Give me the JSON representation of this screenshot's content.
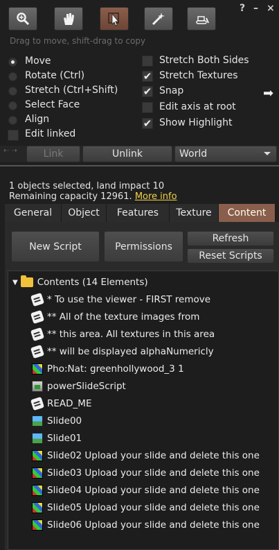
{
  "toolbar": {
    "tools": [
      {
        "name": "focus-tool",
        "icon": "magnifier-icon"
      },
      {
        "name": "grab-tool",
        "icon": "hand-icon"
      },
      {
        "name": "edit-tool",
        "icon": "arrow-cursor-icon",
        "active": true
      },
      {
        "name": "create-tool",
        "icon": "magic-wand-icon"
      },
      {
        "name": "land-tool",
        "icon": "bulldozer-icon"
      }
    ],
    "help_label": "?",
    "minimize_label": "–",
    "close_label": "×",
    "hint": "Drag to move, shift-drag to copy"
  },
  "modes": {
    "move": "Move",
    "rotate": "Rotate (Ctrl)",
    "stretch": "Stretch (Ctrl+Shift)",
    "select_face": "Select Face",
    "align": "Align",
    "selected": "move"
  },
  "edit_linked": {
    "label": "Edit linked",
    "checked": false
  },
  "options": {
    "stretch_both_sides": {
      "label": "Stretch Both Sides",
      "checked": false
    },
    "stretch_textures": {
      "label": "Stretch Textures",
      "checked": true
    },
    "snap": {
      "label": "Snap",
      "checked": true
    },
    "edit_axis_at_root": {
      "label": "Edit axis at root",
      "checked": false
    },
    "show_highlight": {
      "label": "Show Highlight",
      "checked": true
    }
  },
  "link_bar": {
    "link_label": "Link",
    "unlink_label": "Unlink",
    "ruler_value": "World"
  },
  "status": {
    "line1": "1 objects selected, land impact 10",
    "line2_prefix": "Remaining capacity 12961.",
    "more_info": "More info"
  },
  "tabs": [
    "General",
    "Object",
    "Features",
    "Texture",
    "Content"
  ],
  "active_tab": "Content",
  "content_buttons": {
    "new_script": "New Script",
    "permissions": "Permissions",
    "refresh": "Refresh",
    "reset_scripts": "Reset Scripts"
  },
  "inventory": {
    "root": "Contents (14 Elements)",
    "items": [
      {
        "icon": "notecard-icon",
        "label": "* To use the viewer - FIRST remove"
      },
      {
        "icon": "notecard-icon",
        "label": "** All of the texture images from"
      },
      {
        "icon": "notecard-icon",
        "label": "** this area. All textures in this area"
      },
      {
        "icon": "notecard-icon",
        "label": "** will be displayed alphaNumericly"
      },
      {
        "icon": "texture-icon",
        "label": "Pho:Nat: greenhollywood_3 1"
      },
      {
        "icon": "script-icon",
        "label": "powerSlideScript"
      },
      {
        "icon": "notecard-icon",
        "label": "READ_ME"
      },
      {
        "icon": "snapshot-icon",
        "label": "Slide00"
      },
      {
        "icon": "snapshot-icon",
        "label": "Slide01"
      },
      {
        "icon": "texture-icon",
        "label": "Slide02 Upload your slide and delete this one"
      },
      {
        "icon": "texture-icon",
        "label": "Slide03 Upload your slide and delete this one"
      },
      {
        "icon": "texture-icon",
        "label": "Slide04 Upload your slide and delete this one"
      },
      {
        "icon": "texture-icon",
        "label": "Slide05 Upload your slide and delete this one"
      },
      {
        "icon": "texture-icon",
        "label": "Slide06 Upload your slide and delete this one"
      }
    ]
  },
  "colors": {
    "active_tab": "#8a5e4c",
    "link": "#f2d349",
    "background": "#1f1f1f"
  }
}
